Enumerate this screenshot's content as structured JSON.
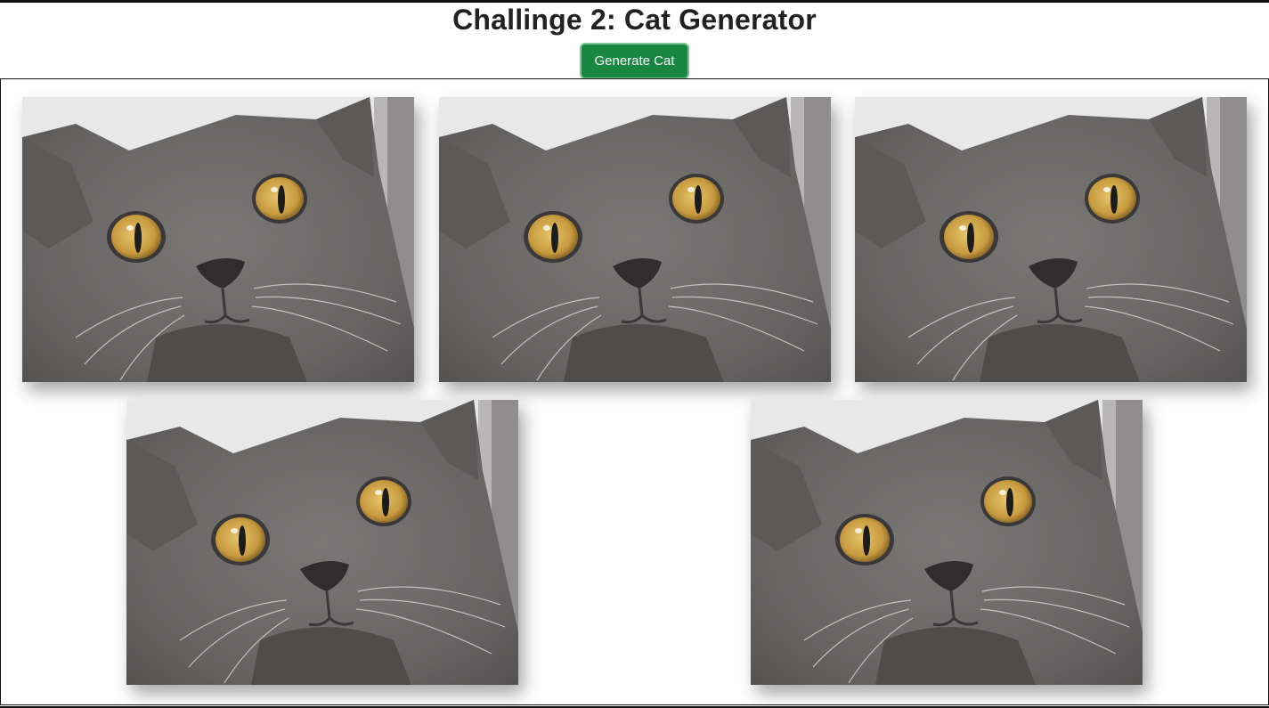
{
  "page": {
    "title": "Challinge 2: Cat Generator",
    "generate_button_label": "Generate Cat"
  },
  "colors": {
    "button_bg": "#198741",
    "button_border": "#7cc494",
    "cat_fur": "#6b6868",
    "cat_eye": "#c9a24a"
  },
  "cats": [
    {
      "icon": "cat-photo"
    },
    {
      "icon": "cat-photo"
    },
    {
      "icon": "cat-photo"
    },
    {
      "icon": "cat-photo"
    },
    {
      "icon": "cat-photo"
    }
  ]
}
